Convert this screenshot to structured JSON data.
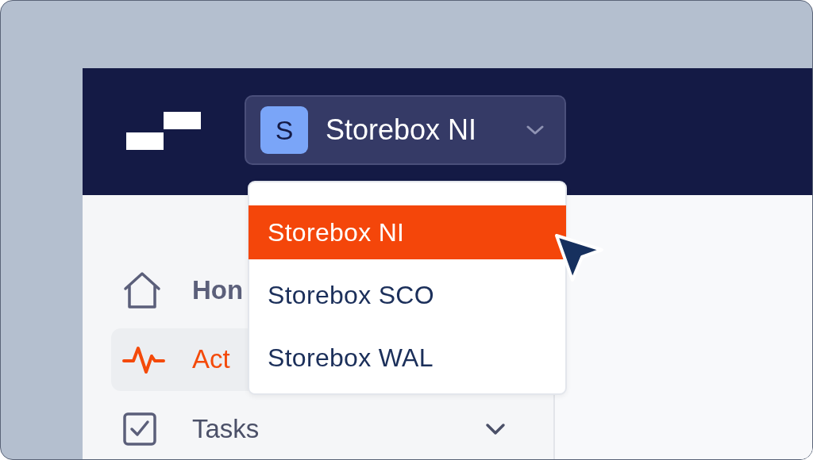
{
  "workspace_selector": {
    "avatar": "S",
    "label": "Storebox NI",
    "expanded": true
  },
  "sidebar": {
    "items": [
      {
        "kind": "home",
        "label": "Hon",
        "selected": false,
        "emphasized": true
      },
      {
        "kind": "activity",
        "label": "Act",
        "selected": true,
        "emphasized": false
      },
      {
        "kind": "tasks",
        "label": "Tasks",
        "selected": false,
        "emphasized": false,
        "expanded": false
      }
    ]
  },
  "dropdown": {
    "items": [
      {
        "label": "Storebox NI",
        "selected": true
      },
      {
        "label": "Storebox SCO",
        "selected": false
      },
      {
        "label": "Storebox WAL",
        "selected": false
      }
    ]
  }
}
